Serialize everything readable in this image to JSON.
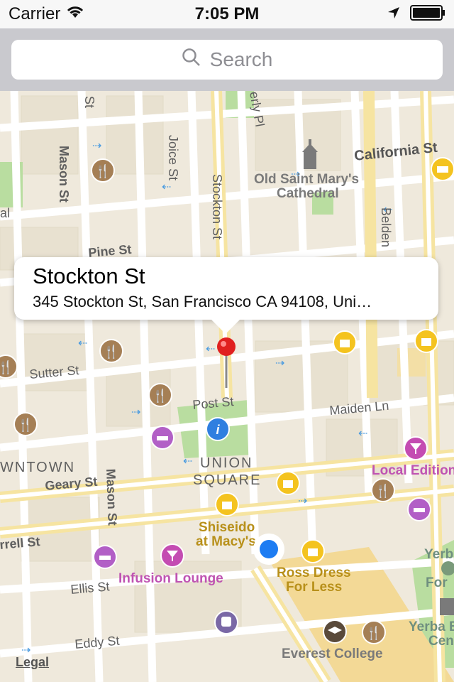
{
  "status_bar": {
    "carrier": "Carrier",
    "time": "7:05 PM"
  },
  "search": {
    "placeholder": "Search"
  },
  "callout": {
    "title": "Stockton St",
    "address": "345 Stockton St, San Francisco CA 94108, Uni…"
  },
  "map_labels": {
    "california_st": "California St",
    "old_saint_marys": "Old Saint Mary's",
    "cathedral": "Cathedral",
    "pine_st": "Pine St",
    "mason_st_top": "Mason St",
    "joice_st": "Joice St",
    "stockton_st": "Stockton St",
    "belden": "Belden",
    "sutter_st": "Sutter St",
    "post_st": "Post St",
    "maiden_ln": "Maiden Ln",
    "downtown": "WNTOWN",
    "geary_st": "Geary St",
    "mason_st_bottom": "Mason St",
    "union": "UNION",
    "square": "SQUARE",
    "local_edition": "Local Edition",
    "shiseido": "Shiseido",
    "at_macys": "at Macy's",
    "farrell_st": "rrell St",
    "ellis_st": "Ellis St",
    "infusion_lounge": "Infusion Lounge",
    "ross_dress": "Ross Dress",
    "for_less": "For Less",
    "eddy_st": "Eddy St",
    "everest_college": "Everest College",
    "yerba1": "Yerb",
    "yerba2": "For",
    "yerba3": "Yerba B",
    "yerba4": "Cen",
    "partial_al": "al",
    "partial_st": "St",
    "partial_pl": "erly Pl"
  },
  "legal": "Legal",
  "colors": {
    "land": "#efe9dc",
    "street": "#ffffff",
    "major_street": "#f8e9a8",
    "park": "#b9dda0",
    "block": "#e8e1d0",
    "restaurant": "#a57f55",
    "shopping": "#f4c31f",
    "hotel": "#b25fc6",
    "nightlife": "#c44cb2",
    "user_location": "#1d7cf2",
    "pin": "#e0201f"
  }
}
